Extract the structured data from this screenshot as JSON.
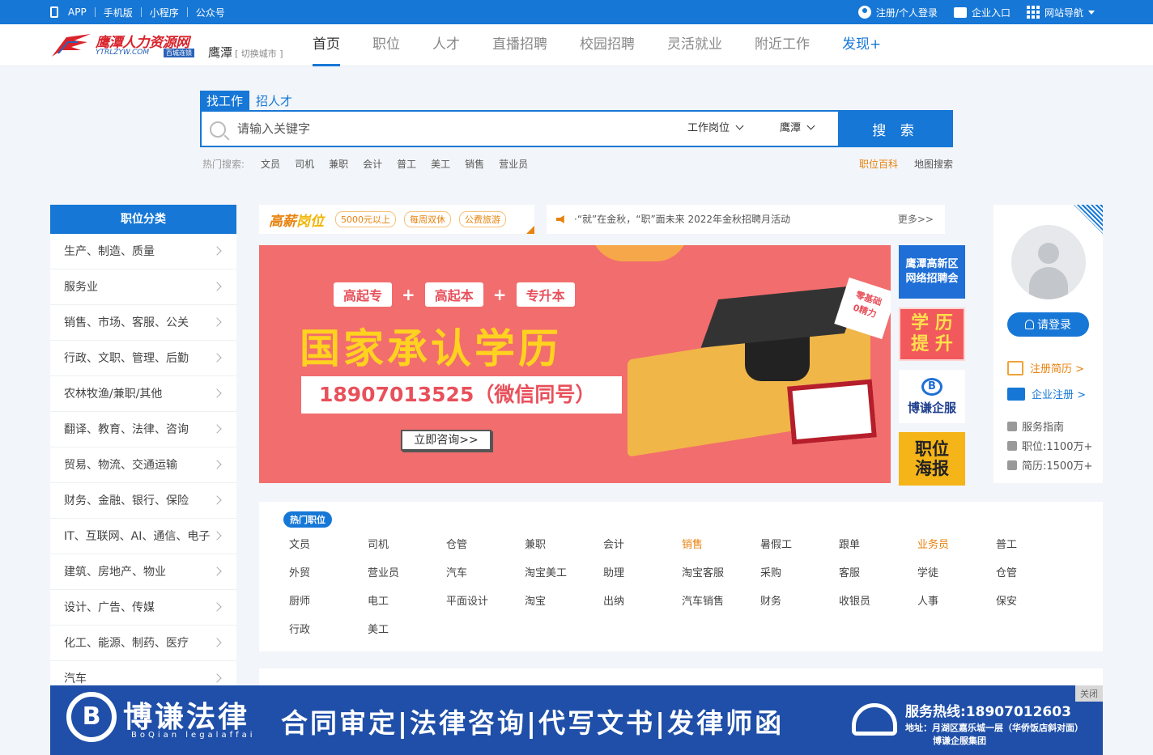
{
  "topbar": {
    "left": [
      "APP",
      "手机版",
      "小程序",
      "公众号"
    ],
    "login": "注册/个人登录",
    "company": "企业入口",
    "sitenav": "网站导航"
  },
  "header": {
    "logo_cn": "鹰潭人力资源网",
    "logo_en": "YTRLZYW.COM",
    "logo_badge": "百城连锁",
    "city": "鹰潭",
    "switch_city": "[ 切换城市 ]",
    "nav": [
      "首页",
      "职位",
      "人才",
      "直播招聘",
      "校园招聘",
      "灵活就业",
      "附近工作",
      "发现+"
    ]
  },
  "search": {
    "tabs": [
      "找工作",
      "招人才"
    ],
    "placeholder": "请输入关键字",
    "select_type": "工作岗位",
    "select_city": "鹰潭",
    "button": "搜 索",
    "hot_label": "热门搜索:",
    "hot_keywords": [
      "文员",
      "司机",
      "兼职",
      "会计",
      "普工",
      "美工",
      "销售",
      "营业员"
    ],
    "link_baike": "职位百科",
    "link_map": "地图搜索"
  },
  "categories": {
    "title": "职位分类",
    "items": [
      "生产、制造、质量",
      "服务业",
      "销售、市场、客服、公关",
      "行政、文职、管理、后勤",
      "农林牧渔/兼职/其他",
      "翻译、教育、法律、咨询",
      "贸易、物流、交通运输",
      "财务、金融、银行、保险",
      "IT、互联网、AI、通信、电子",
      "建筑、房地产、物业",
      "设计、广告、传媒",
      "化工、能源、制药、医疗",
      "汽车"
    ]
  },
  "highpay": {
    "brand_a": "高薪",
    "brand_b": "岗位",
    "tags": [
      "5000元以上",
      "每周双休",
      "公费旅游"
    ]
  },
  "notice": {
    "text": "·“就”在金秋，“职”面未来 2022年金秋招聘月活动",
    "more": "更多>>"
  },
  "banner": {
    "pills": [
      "高起专",
      "高起本",
      "专升本"
    ],
    "plus": "+",
    "headline": "国家承认学历",
    "phone": "18907013525（微信同号）",
    "cta": "立即咨询>>",
    "sticker": "零基础\n0精力"
  },
  "side_ads": {
    "ad1": "鹰潭高新区\n网络招聘会",
    "ad2": "学 历\n提 升",
    "ad3_logo": "B",
    "ad3": "博谦企服",
    "ad4": "职位\n海报"
  },
  "user_panel": {
    "login": "请登录",
    "register_resume": "注册简历 >",
    "register_company": "企业注册 >",
    "service": "服务指南",
    "jobs": "职位:1100万+",
    "resumes": "简历:1500万+"
  },
  "hot_jobs": {
    "title": "热门职位",
    "items": [
      {
        "t": "文员",
        "o": false
      },
      {
        "t": "司机",
        "o": false
      },
      {
        "t": "仓管",
        "o": false
      },
      {
        "t": "兼职",
        "o": false
      },
      {
        "t": "会计",
        "o": false
      },
      {
        "t": "销售",
        "o": true
      },
      {
        "t": "暑假工",
        "o": false
      },
      {
        "t": "跟单",
        "o": false
      },
      {
        "t": "业务员",
        "o": true
      },
      {
        "t": "普工",
        "o": false
      },
      {
        "t": "外贸",
        "o": false
      },
      {
        "t": "营业员",
        "o": false
      },
      {
        "t": "汽车",
        "o": false
      },
      {
        "t": "淘宝美工",
        "o": false
      },
      {
        "t": "助理",
        "o": false
      },
      {
        "t": "淘宝客服",
        "o": false
      },
      {
        "t": "采购",
        "o": false
      },
      {
        "t": "客服",
        "o": false
      },
      {
        "t": "学徒",
        "o": false
      },
      {
        "t": "仓管",
        "o": false
      },
      {
        "t": "厨师",
        "o": false
      },
      {
        "t": "电工",
        "o": false
      },
      {
        "t": "平面设计",
        "o": false
      },
      {
        "t": "淘宝",
        "o": false
      },
      {
        "t": "出纳",
        "o": false
      },
      {
        "t": "汽车销售",
        "o": false
      },
      {
        "t": "财务",
        "o": false
      },
      {
        "t": "收银员",
        "o": false
      },
      {
        "t": "人事",
        "o": false
      },
      {
        "t": "保安",
        "o": false
      },
      {
        "t": "行政",
        "o": false
      },
      {
        "t": "美工",
        "o": false
      }
    ]
  },
  "bottom_ad": {
    "logo": "B",
    "brand": "博谦法律",
    "brand_en": "BoQian legalaffai",
    "slogan": "合同审定|法律咨询|代写文书|发律师函",
    "hotline": "服务热线:18907012603",
    "address": "地址：月湖区嘉乐城一层（华侨饭店斜对面）",
    "group": "博谦企服集团",
    "close": "关闭"
  },
  "colors": {
    "primary": "#1677d6",
    "accent": "#e8820e",
    "banner": "#f26d6d"
  }
}
